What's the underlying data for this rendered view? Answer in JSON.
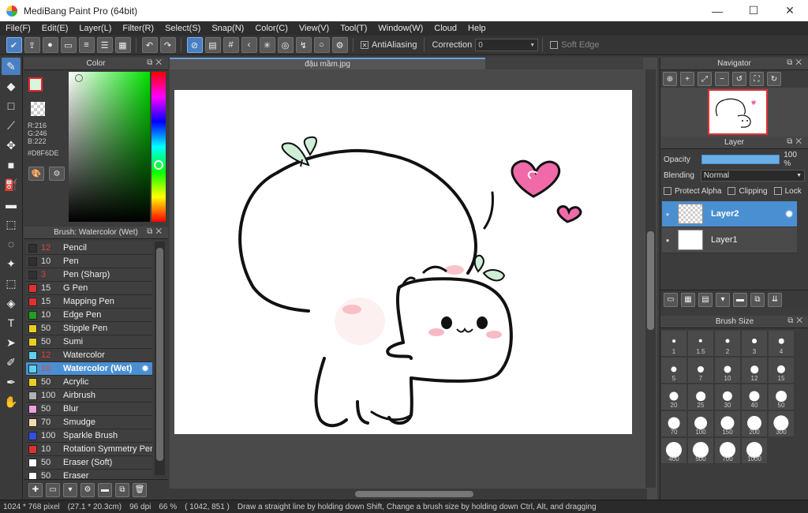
{
  "window": {
    "title": "MediBang Paint Pro (64bit)",
    "min": "—",
    "max": "☐",
    "close": "✕"
  },
  "menu": [
    "File(F)",
    "Edit(E)",
    "Layer(L)",
    "Filter(R)",
    "Select(S)",
    "Snap(N)",
    "Color(C)",
    "View(V)",
    "Tool(T)",
    "Window(W)",
    "Cloud",
    "Help"
  ],
  "toolbar": {
    "antialiasing_label": "AntiAliasing",
    "correction_label": "Correction",
    "correction_value": "0",
    "soft_edge_label": "Soft Edge"
  },
  "color_panel": {
    "title": "Color",
    "rgb": {
      "r": "R:216",
      "g": "G:246",
      "b": "B:222"
    },
    "hex": "#D8F6DE",
    "current_color": "#D8F6DE"
  },
  "brush_panel": {
    "title": "Brush: Watercolor (Wet)",
    "items": [
      {
        "size": "12",
        "name": "Pencil",
        "color": "#303030",
        "red": true
      },
      {
        "size": "10",
        "name": "Pen",
        "color": "#303030",
        "red": false
      },
      {
        "size": "3",
        "name": "Pen (Sharp)",
        "color": "#303030",
        "red": true
      },
      {
        "size": "15",
        "name": "G Pen",
        "color": "#e03030",
        "red": false
      },
      {
        "size": "15",
        "name": "Mapping Pen",
        "color": "#e03030",
        "red": false
      },
      {
        "size": "10",
        "name": "Edge Pen",
        "color": "#20a020",
        "red": false
      },
      {
        "size": "50",
        "name": "Stipple Pen",
        "color": "#e8d020",
        "red": false
      },
      {
        "size": "50",
        "name": "Sumi",
        "color": "#e8d020",
        "red": false
      },
      {
        "size": "12",
        "name": "Watercolor",
        "color": "#60d0f0",
        "red": true
      },
      {
        "size": "10",
        "name": "Watercolor (Wet)",
        "color": "#60d0f0",
        "red": true,
        "selected": true
      },
      {
        "size": "50",
        "name": "Acrylic",
        "color": "#e8d020",
        "red": false
      },
      {
        "size": "100",
        "name": "Airbrush",
        "color": "#b0b0b0",
        "red": false
      },
      {
        "size": "50",
        "name": "Blur",
        "color": "#f0a0e0",
        "red": false
      },
      {
        "size": "70",
        "name": "Smudge",
        "color": "#f8d8b0",
        "red": false
      },
      {
        "size": "100",
        "name": "Sparkle Brush",
        "color": "#3050e0",
        "red": false
      },
      {
        "size": "10",
        "name": "Rotation Symmetry Pen",
        "color": "#e03030",
        "red": false
      },
      {
        "size": "50",
        "name": "Eraser (Soft)",
        "color": "#ffffff",
        "red": false
      },
      {
        "size": "50",
        "name": "Eraser",
        "color": "#ffffff",
        "red": false
      }
    ]
  },
  "canvas": {
    "tab_title": "đậu mầm.jpg"
  },
  "navigator": {
    "title": "Navigator"
  },
  "layer_panel": {
    "title": "Layer",
    "opacity_label": "Opacity",
    "opacity_value": "100 %",
    "blending_label": "Blending",
    "blending_value": "Normal",
    "protect_alpha": "Protect Alpha",
    "clipping": "Clipping",
    "lock": "Lock",
    "layers": [
      {
        "name": "Layer2",
        "selected": true
      },
      {
        "name": "Layer1",
        "selected": false
      }
    ]
  },
  "brush_size_panel": {
    "title": "Brush Size",
    "sizes": [
      "1",
      "1.5",
      "2",
      "3",
      "4",
      "5",
      "7",
      "10",
      "12",
      "15",
      "20",
      "25",
      "30",
      "40",
      "50",
      "70",
      "100",
      "150",
      "200",
      "300",
      "400",
      "500",
      "700",
      "1000"
    ]
  },
  "status": {
    "size": "1024 * 768 pixel",
    "cm": "(27.1 * 20.3cm)",
    "dpi": "96 dpi",
    "zoom": "66 %",
    "coords": "( 1042, 851 )",
    "hint": "Draw a straight line by holding down Shift, Change a brush size by holding down Ctrl, Alt, and dragging"
  }
}
